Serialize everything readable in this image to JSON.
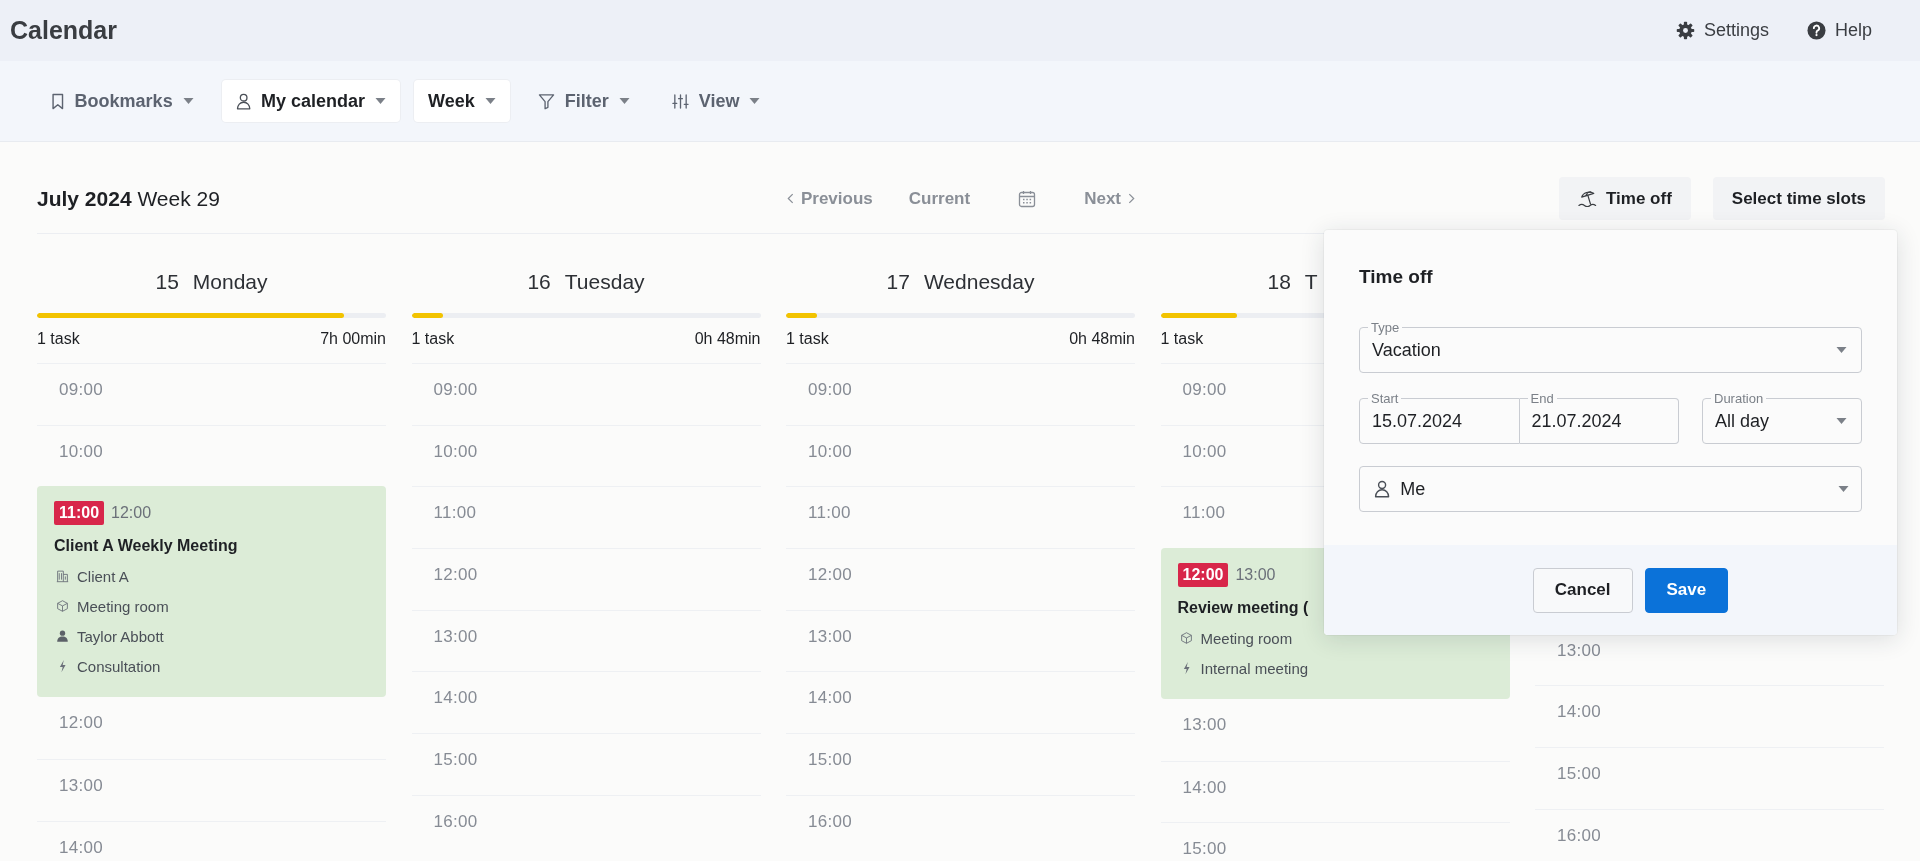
{
  "app_bar": {
    "title": "Calendar",
    "actions": [
      {
        "label": "Settings",
        "kind": "gear"
      },
      {
        "label": "Help",
        "kind": "help"
      }
    ]
  },
  "toolbar": [
    {
      "label": "Bookmarks",
      "kind": "bookmark",
      "active": false
    },
    {
      "label": "My calendar",
      "kind": "person",
      "active": true
    },
    {
      "label": "Week",
      "kind": "plain",
      "active": true
    },
    {
      "label": "Filter",
      "kind": "funnel",
      "active": false
    },
    {
      "label": "View",
      "kind": "sliders",
      "active": false
    }
  ],
  "period": {
    "month": "July 2024",
    "week": "Week 29"
  },
  "navigation": [
    {
      "kind": "previous",
      "label": "Previous"
    },
    {
      "kind": "current",
      "label": "Current"
    },
    {
      "kind": "calendar"
    },
    {
      "kind": "next",
      "label": "Next"
    }
  ],
  "actions": [
    {
      "label": "Time off",
      "kind": "umbrella"
    },
    {
      "label": "Select time slots",
      "kind": "plain"
    }
  ],
  "days": [
    {
      "date": "15",
      "name": "Monday",
      "level": 0.88,
      "tasks": "1 task",
      "duration": "7h 00min",
      "slots": [
        {
          "kind": "hour",
          "time": "09:00"
        },
        {
          "kind": "hour",
          "time": "10:00"
        },
        {
          "kind": "event",
          "start": "11:00",
          "end": "12:00",
          "title": "Client A Weekly Meeting",
          "details": [
            {
              "kind": "building",
              "text": "Client A"
            },
            {
              "kind": "cube",
              "text": "Meeting room"
            },
            {
              "kind": "user",
              "text": "Taylor Abbott"
            },
            {
              "kind": "bolt",
              "text": "Consultation"
            }
          ]
        },
        {
          "kind": "hour",
          "time": "12:00"
        },
        {
          "kind": "hour",
          "time": "13:00"
        },
        {
          "kind": "hour",
          "time": "14:00"
        }
      ]
    },
    {
      "date": "16",
      "name": "Tuesday",
      "level": 0.09,
      "tasks": "1 task",
      "duration": "0h 48min",
      "slots": [
        {
          "kind": "hour",
          "time": "09:00"
        },
        {
          "kind": "hour",
          "time": "10:00"
        },
        {
          "kind": "hour",
          "time": "11:00"
        },
        {
          "kind": "hour",
          "time": "12:00"
        },
        {
          "kind": "hour",
          "time": "13:00"
        },
        {
          "kind": "hour",
          "time": "14:00"
        },
        {
          "kind": "hour",
          "time": "15:00"
        },
        {
          "kind": "hour",
          "time": "16:00"
        }
      ]
    },
    {
      "date": "17",
      "name": "Wednesday",
      "level": 0.09,
      "tasks": "1 task",
      "duration": "0h 48min",
      "slots": [
        {
          "kind": "hour",
          "time": "09:00"
        },
        {
          "kind": "hour",
          "time": "10:00"
        },
        {
          "kind": "hour",
          "time": "11:00"
        },
        {
          "kind": "hour",
          "time": "12:00"
        },
        {
          "kind": "hour",
          "time": "13:00"
        },
        {
          "kind": "hour",
          "time": "14:00"
        },
        {
          "kind": "hour",
          "time": "15:00"
        },
        {
          "kind": "hour",
          "time": "16:00"
        }
      ]
    },
    {
      "date": "18",
      "name": "T",
      "level": 0.22,
      "tasks": "1 task",
      "slots": [
        {
          "kind": "hour",
          "time": "09:00"
        },
        {
          "kind": "hour",
          "time": "10:00"
        },
        {
          "kind": "hour",
          "time": "11:00"
        },
        {
          "kind": "event",
          "start": "12:00",
          "end": "13:00",
          "title": "Review meeting (",
          "details": [
            {
              "kind": "cube",
              "text": "Meeting room"
            },
            {
              "kind": "bolt",
              "text": "Internal meeting"
            }
          ]
        },
        {
          "kind": "hour",
          "time": "13:00"
        },
        {
          "kind": "hour",
          "time": "14:00"
        },
        {
          "kind": "hour",
          "time": "15:00"
        }
      ]
    },
    {
      "slots": [
        {
          "kind": "hour",
          "time": "13:00"
        },
        {
          "kind": "hour",
          "time": "14:00"
        },
        {
          "kind": "hour",
          "time": "15:00"
        },
        {
          "kind": "hour",
          "time": "16:00"
        }
      ]
    }
  ],
  "time_off_dialog": {
    "title": "Time off",
    "type": {
      "label": "Type",
      "value": "Vacation"
    },
    "start": {
      "label": "Start",
      "value": "15.07.2024"
    },
    "end": {
      "label": "End",
      "value": "21.07.2024"
    },
    "duration": {
      "label": "Duration",
      "value": "All day"
    },
    "person": {
      "value": "Me"
    },
    "buttons": [
      {
        "label": "Cancel",
        "kind": "secondary"
      },
      {
        "label": "Save",
        "kind": "primary"
      }
    ]
  }
}
